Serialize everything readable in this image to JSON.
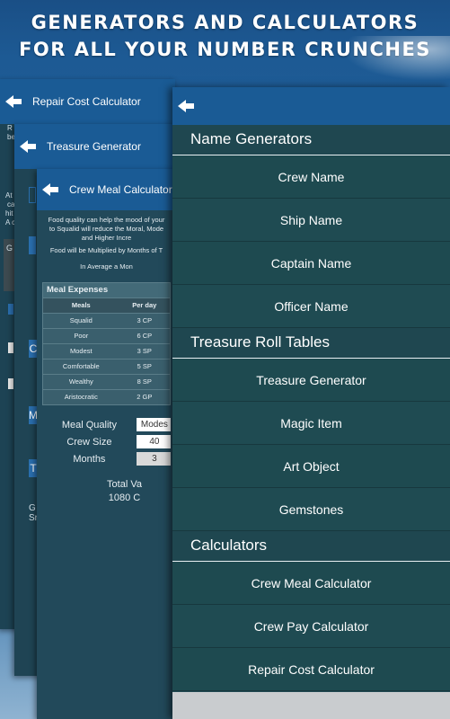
{
  "promo": {
    "line1": "GENERATORS AND CALCULATORS",
    "line2": "FOR ALL YOUR NUMBER CRUNCHES"
  },
  "screens": {
    "repair": {
      "title": "Repair Cost Calculator"
    },
    "treasure": {
      "title": "Treasure Generator"
    },
    "meal": {
      "title": "Crew Meal Calculator",
      "intro": "Food quality can help the mood of your",
      "intro2": "to Squalid will reduce the Moral, Mode",
      "intro3": "and Higher Incre",
      "note": "Food will be Multiplied by Months of T",
      "note2": "In Average a Mon",
      "table_title": "Meal Expenses",
      "columns": [
        "Meals",
        "Per day"
      ],
      "rows": [
        [
          "Squalid",
          "3 CP"
        ],
        [
          "Poor",
          "6 CP"
        ],
        [
          "Modest",
          "3 SP"
        ],
        [
          "Comfortable",
          "5 SP"
        ],
        [
          "Wealthy",
          "8 SP"
        ],
        [
          "Aristocratic",
          "2 GP"
        ]
      ],
      "quality_label": "Meal Quality",
      "quality_value": "Modes",
      "crew_label": "Crew Size",
      "crew_value": "40",
      "months_label": "Months",
      "months_value": "3",
      "total_label": "Total Va",
      "total_value": "1080 C"
    }
  },
  "fragments": {
    "a": "R",
    "b": "be",
    "c": "At",
    "d": "ca",
    "e": "hit",
    "f": "A c",
    "g": "G",
    "h": "C",
    "i": "M",
    "j": "T",
    "k": "G",
    "l": "Sr"
  },
  "front": {
    "sections": [
      {
        "title": "Name Generators",
        "items": [
          "Crew Name",
          "Ship Name",
          "Captain Name",
          "Officer Name"
        ]
      },
      {
        "title": "Treasure Roll Tables",
        "items": [
          "Treasure Generator",
          "Magic Item",
          "Art Object",
          "Gemstones"
        ]
      },
      {
        "title": "Calculators",
        "items": [
          "Crew Meal Calculator",
          "Crew Pay Calculator",
          "Repair Cost Calculator"
        ]
      }
    ]
  }
}
